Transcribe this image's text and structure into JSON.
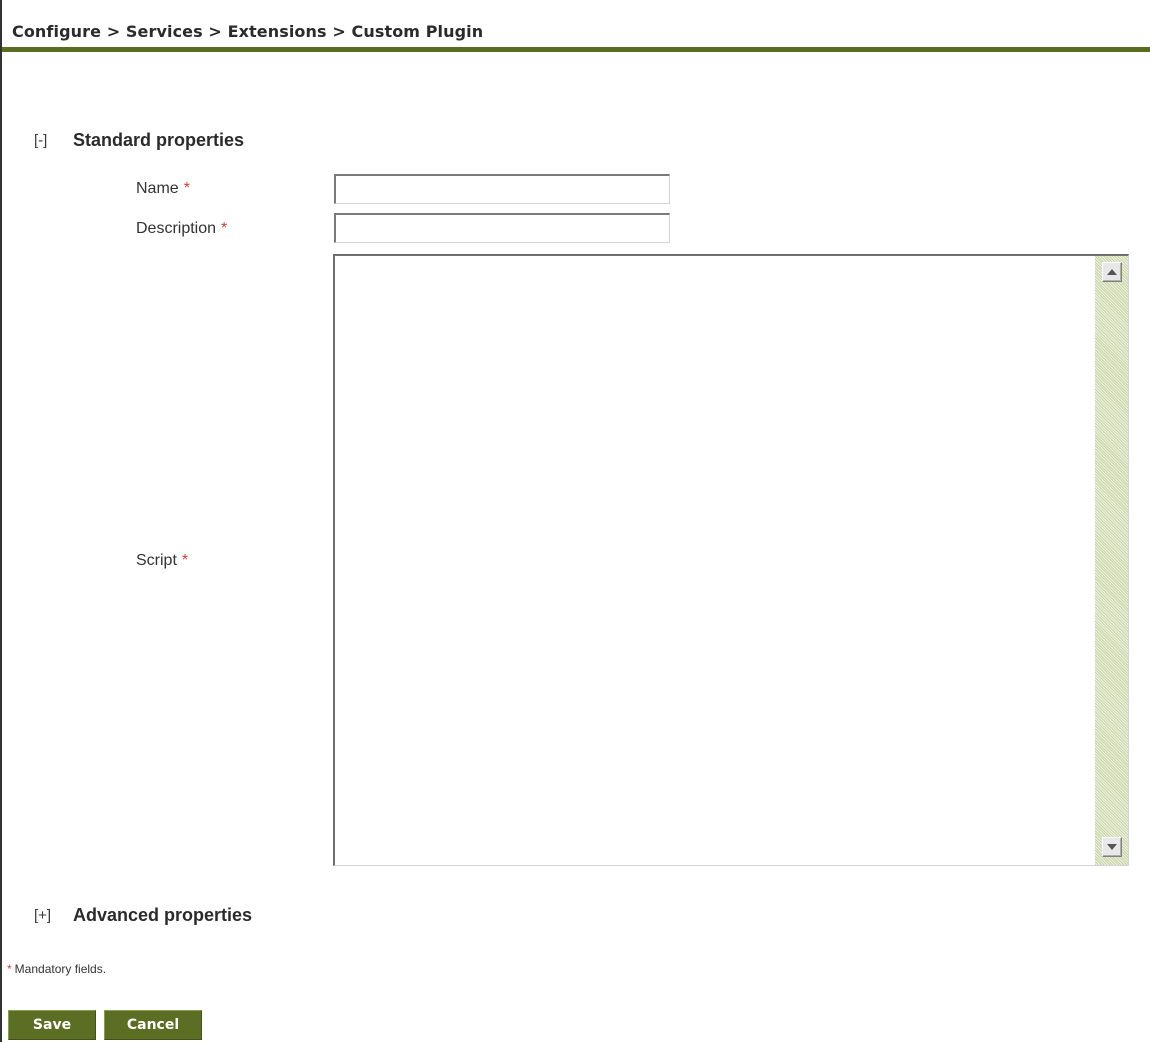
{
  "breadcrumb": {
    "text": "Configure > Services > Extensions > Custom Plugin"
  },
  "standard_section": {
    "toggle": "[-]",
    "title": "Standard properties",
    "fields": {
      "name": {
        "label": "Name",
        "required_mark": "*",
        "value": ""
      },
      "description": {
        "label": "Description",
        "required_mark": "*",
        "value": ""
      },
      "script": {
        "label": "Script",
        "required_mark": "*",
        "value": ""
      }
    }
  },
  "advanced_section": {
    "toggle": "[+]",
    "title": "Advanced properties"
  },
  "mandatory_note": {
    "mark": "*",
    "text": "Mandatory fields."
  },
  "buttons": {
    "save": "Save",
    "cancel": "Cancel"
  },
  "colors": {
    "accent": "#5a6b22",
    "button_bg": "#5c6d24",
    "required": "#d23c3c",
    "scrollbar_track": "#dfe8c8"
  },
  "icons": {
    "scroll_up": "scroll-up-arrow-icon",
    "scroll_down": "scroll-down-arrow-icon"
  }
}
